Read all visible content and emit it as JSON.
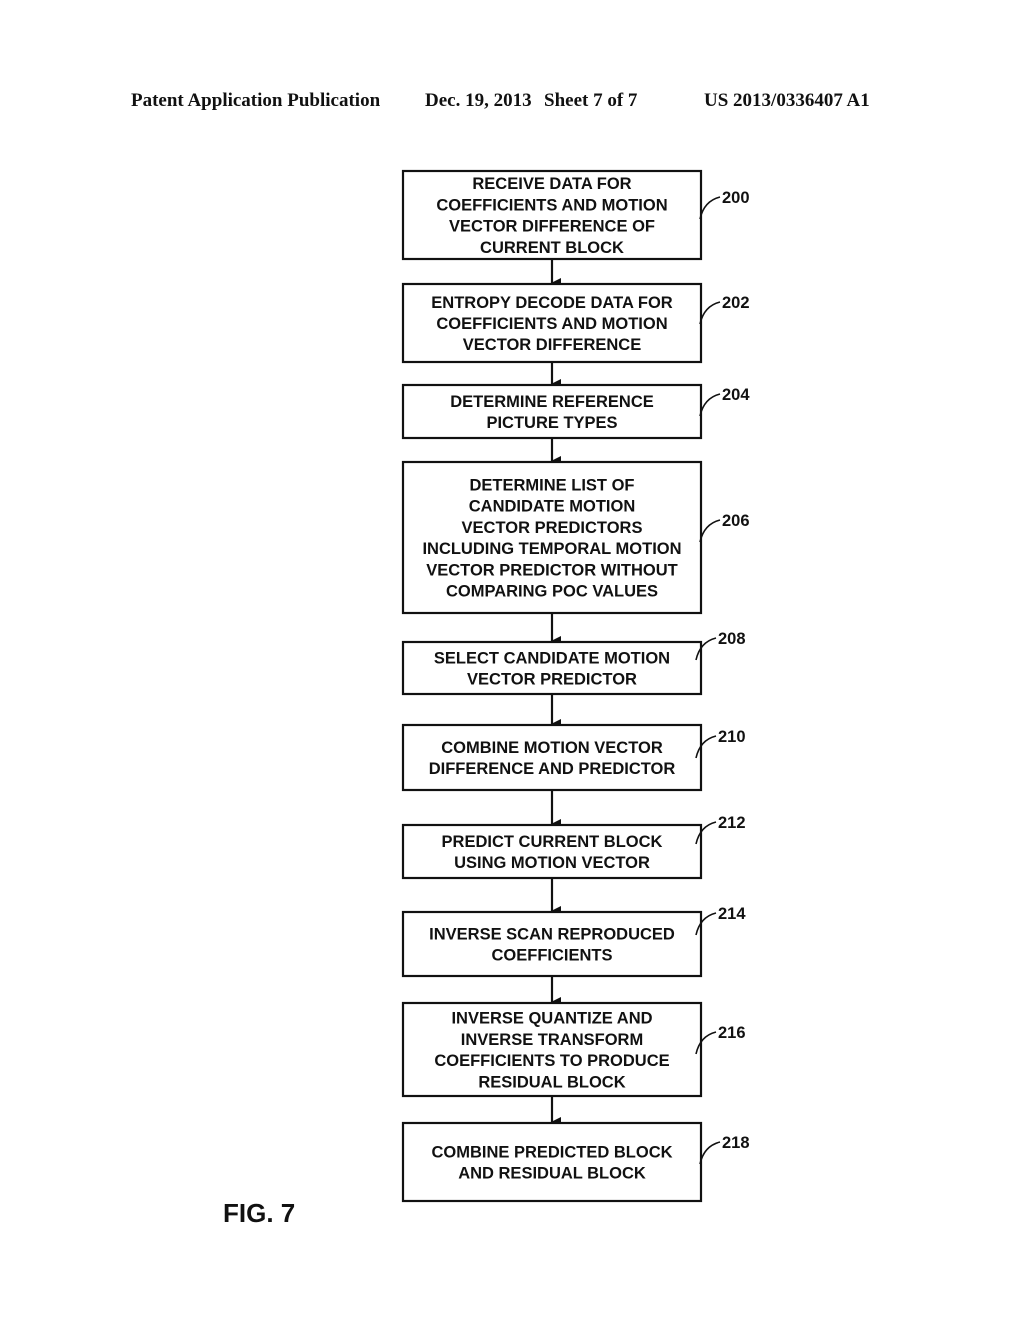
{
  "header": {
    "publication": "Patent Application Publication",
    "date": "Dec. 19, 2013",
    "sheet": "Sheet 7 of 7",
    "number": "US 2013/0336407 A1"
  },
  "figure_label": "FIG. 7",
  "steps": [
    {
      "ref": "200",
      "lines": [
        "RECEIVE DATA FOR",
        "COEFFICIENTS AND MOTION",
        "VECTOR DIFFERENCE OF",
        "CURRENT BLOCK"
      ]
    },
    {
      "ref": "202",
      "lines": [
        "ENTROPY DECODE DATA FOR",
        "COEFFICIENTS AND MOTION",
        "VECTOR DIFFERENCE"
      ]
    },
    {
      "ref": "204",
      "lines": [
        "DETERMINE REFERENCE",
        "PICTURE TYPES"
      ]
    },
    {
      "ref": "206",
      "lines": [
        "DETERMINE LIST OF",
        "CANDIDATE MOTION",
        "VECTOR PREDICTORS",
        "INCLUDING TEMPORAL MOTION",
        "VECTOR PREDICTOR WITHOUT",
        "COMPARING POC VALUES"
      ]
    },
    {
      "ref": "208",
      "lines": [
        "SELECT CANDIDATE MOTION",
        "VECTOR PREDICTOR"
      ]
    },
    {
      "ref": "210",
      "lines": [
        "COMBINE MOTION VECTOR",
        "DIFFERENCE AND PREDICTOR"
      ]
    },
    {
      "ref": "212",
      "lines": [
        "PREDICT CURRENT BLOCK",
        "USING MOTION VECTOR"
      ]
    },
    {
      "ref": "214",
      "lines": [
        "INVERSE SCAN REPRODUCED",
        "COEFFICIENTS"
      ]
    },
    {
      "ref": "216",
      "lines": [
        "INVERSE QUANTIZE AND",
        "INVERSE TRANSFORM",
        "COEFFICIENTS TO PRODUCE",
        "RESIDUAL BLOCK"
      ]
    },
    {
      "ref": "218",
      "lines": [
        "COMBINE PREDICTED BLOCK",
        "AND RESIDUAL BLOCK"
      ]
    }
  ],
  "edges": [
    [
      "200",
      "202"
    ],
    [
      "202",
      "204"
    ],
    [
      "204",
      "206"
    ],
    [
      "206",
      "208"
    ],
    [
      "208",
      "210"
    ],
    [
      "210",
      "212"
    ],
    [
      "212",
      "214"
    ],
    [
      "214",
      "216"
    ],
    [
      "216",
      "218"
    ]
  ]
}
